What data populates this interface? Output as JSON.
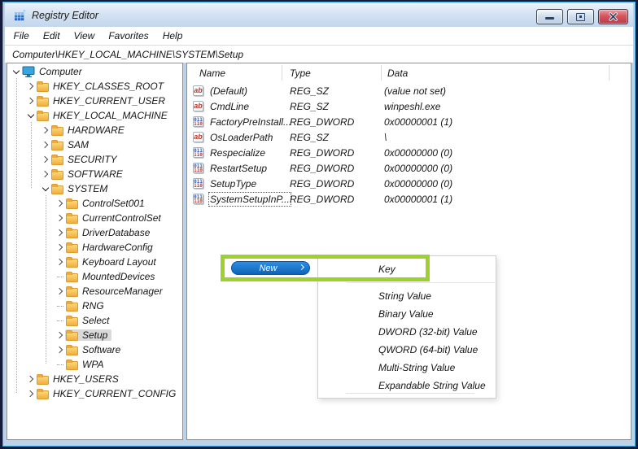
{
  "window": {
    "title": "Registry Editor",
    "controls": {
      "minimize": "minimize",
      "maximize": "maximize",
      "close": "close"
    }
  },
  "menubar": {
    "items": [
      "File",
      "Edit",
      "View",
      "Favorites",
      "Help"
    ]
  },
  "address": "Computer\\HKEY_LOCAL_MACHINE\\SYSTEM\\Setup",
  "tree": {
    "items": [
      {
        "label": "Computer",
        "level": 0,
        "state": "expanded",
        "icon": "computer-icon",
        "selected": false
      },
      {
        "label": "HKEY_CLASSES_ROOT",
        "level": 1,
        "state": "collapsed",
        "icon": "folder-icon",
        "selected": false
      },
      {
        "label": "HKEY_CURRENT_USER",
        "level": 1,
        "state": "collapsed",
        "icon": "folder-icon",
        "selected": false
      },
      {
        "label": "HKEY_LOCAL_MACHINE",
        "level": 1,
        "state": "expanded",
        "icon": "folder-icon",
        "selected": false
      },
      {
        "label": "HARDWARE",
        "level": 2,
        "state": "collapsed",
        "icon": "folder-icon",
        "selected": false
      },
      {
        "label": "SAM",
        "level": 2,
        "state": "collapsed",
        "icon": "folder-icon",
        "selected": false
      },
      {
        "label": "SECURITY",
        "level": 2,
        "state": "collapsed",
        "icon": "folder-icon",
        "selected": false
      },
      {
        "label": "SOFTWARE",
        "level": 2,
        "state": "collapsed",
        "icon": "folder-icon",
        "selected": false
      },
      {
        "label": "SYSTEM",
        "level": 2,
        "state": "expanded",
        "icon": "folder-icon",
        "selected": false
      },
      {
        "label": "ControlSet001",
        "level": 3,
        "state": "collapsed",
        "icon": "folder-icon",
        "selected": false
      },
      {
        "label": "CurrentControlSet",
        "level": 3,
        "state": "collapsed",
        "icon": "folder-icon",
        "selected": false
      },
      {
        "label": "DriverDatabase",
        "level": 3,
        "state": "collapsed",
        "icon": "folder-icon",
        "selected": false
      },
      {
        "label": "HardwareConfig",
        "level": 3,
        "state": "collapsed",
        "icon": "folder-icon",
        "selected": false
      },
      {
        "label": "Keyboard Layout",
        "level": 3,
        "state": "collapsed",
        "icon": "folder-icon",
        "selected": false
      },
      {
        "label": "MountedDevices",
        "level": 3,
        "state": "leaf",
        "icon": "folder-icon",
        "selected": false
      },
      {
        "label": "ResourceManager",
        "level": 3,
        "state": "collapsed",
        "icon": "folder-icon",
        "selected": false
      },
      {
        "label": "RNG",
        "level": 3,
        "state": "leaf",
        "icon": "folder-icon",
        "selected": false
      },
      {
        "label": "Select",
        "level": 3,
        "state": "leaf",
        "icon": "folder-icon",
        "selected": false
      },
      {
        "label": "Setup",
        "level": 3,
        "state": "collapsed",
        "icon": "folder-icon",
        "selected": true
      },
      {
        "label": "Software",
        "level": 3,
        "state": "collapsed",
        "icon": "folder-icon",
        "selected": false
      },
      {
        "label": "WPA",
        "level": 3,
        "state": "leaf",
        "icon": "folder-icon",
        "selected": false
      },
      {
        "label": "HKEY_USERS",
        "level": 1,
        "state": "collapsed",
        "icon": "folder-icon",
        "selected": false
      },
      {
        "label": "HKEY_CURRENT_CONFIG",
        "level": 1,
        "state": "collapsed",
        "icon": "folder-icon",
        "selected": false
      }
    ]
  },
  "values": {
    "columns": [
      "Name",
      "Type",
      "Data"
    ],
    "rows": [
      {
        "icon": "string-value-icon",
        "name": "(Default)",
        "type": "REG_SZ",
        "data": "(value not set)",
        "focused": false
      },
      {
        "icon": "string-value-icon",
        "name": "CmdLine",
        "type": "REG_SZ",
        "data": "winpeshl.exe",
        "focused": false
      },
      {
        "icon": "dword-value-icon",
        "name": "FactoryPreInstall...",
        "type": "REG_DWORD",
        "data": "0x00000001 (1)",
        "focused": false
      },
      {
        "icon": "string-value-icon",
        "name": "OsLoaderPath",
        "type": "REG_SZ",
        "data": "\\",
        "focused": false
      },
      {
        "icon": "dword-value-icon",
        "name": "Respecialize",
        "type": "REG_DWORD",
        "data": "0x00000000 (0)",
        "focused": false
      },
      {
        "icon": "dword-value-icon",
        "name": "RestartSetup",
        "type": "REG_DWORD",
        "data": "0x00000000 (0)",
        "focused": false
      },
      {
        "icon": "dword-value-icon",
        "name": "SetupType",
        "type": "REG_DWORD",
        "data": "0x00000000 (0)",
        "focused": false
      },
      {
        "icon": "dword-value-icon",
        "name": "SystemSetupInP...",
        "type": "REG_DWORD",
        "data": "0x00000001 (1)",
        "focused": true
      }
    ]
  },
  "context_menu": {
    "new_label": "New",
    "key_item": "Key",
    "items": [
      "String Value",
      "Binary Value",
      "DWORD (32-bit) Value",
      "QWORD (64-bit) Value",
      "Multi-String Value",
      "Expandable String Value"
    ]
  },
  "colors": {
    "annotation_green": "#9ed12f",
    "menu_selection_blue": "#1374cc",
    "folder_yellow": "#f2b244",
    "close_button_red": "#c44450",
    "frame_blue": "#bcd1ea"
  }
}
